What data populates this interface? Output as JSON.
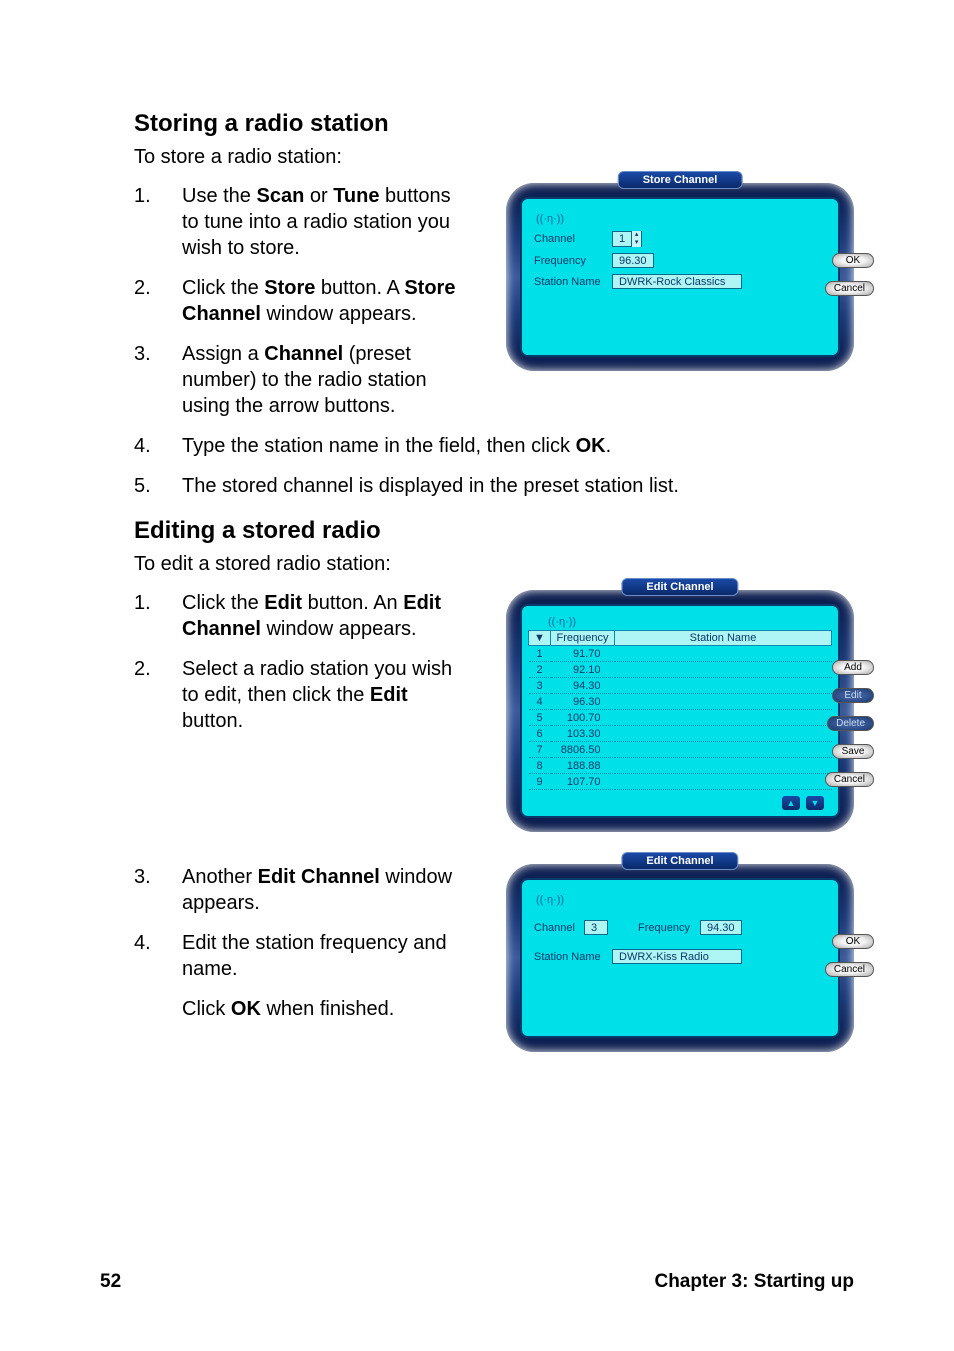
{
  "section1": {
    "heading": "Storing a radio station",
    "intro": "To store a radio station:",
    "steps_left": [
      {
        "n": "1.",
        "pre": "Use the ",
        "b1": "Scan",
        "mid": " or ",
        "b2": "Tune",
        "post": " buttons to tune into a radio station you wish to store."
      },
      {
        "n": "2.",
        "pre": "Click the ",
        "b1": "Store",
        "mid": " button. A ",
        "b2": "Store Channel",
        "post": " window appears."
      },
      {
        "n": "3.",
        "pre": "Assign a ",
        "b1": "Channel",
        "mid": "",
        "b2": "",
        "post": " (preset number) to the radio station using the arrow buttons."
      }
    ],
    "steps_full": [
      {
        "n": "4.",
        "pre": "Type the station name in the field, then click ",
        "b1": "OK",
        "mid": "",
        "b2": "",
        "post": "."
      },
      {
        "n": "5.",
        "pre": "The stored channel is displayed in the preset station list.",
        "b1": "",
        "mid": "",
        "b2": "",
        "post": ""
      }
    ]
  },
  "store_panel": {
    "title": "Store Channel",
    "icon": "((·η·))",
    "channel_label": "Channel",
    "channel_value": "1",
    "freq_label": "Frequency",
    "freq_value": "96.30",
    "name_label": "Station Name",
    "name_value": "DWRK-Rock Classics",
    "ok": "OK",
    "cancel": "Cancel"
  },
  "section2": {
    "heading": "Editing a stored radio",
    "intro": "To edit a stored radio station:",
    "steps_left": [
      {
        "n": "1.",
        "pre": "Click the ",
        "b1": "Edit",
        "mid": " button. An ",
        "b2": "Edit Channel",
        "post": " window appears."
      },
      {
        "n": "2.",
        "pre": "Select a radio station you wish to edit, then click the ",
        "b1": "Edit",
        "mid": "",
        "b2": "",
        "post": " button."
      }
    ],
    "steps_left2": [
      {
        "n": "3.",
        "pre": "Another ",
        "b1": "Edit Channel",
        "mid": "",
        "b2": "",
        "post": " window appears."
      },
      {
        "n": "4.",
        "pre": "Edit the station frequency and name.",
        "b1": "",
        "mid": "",
        "b2": "",
        "post": ""
      }
    ],
    "extra": {
      "pre": "Click ",
      "b1": "OK",
      "post": " when finished."
    }
  },
  "edit_list_panel": {
    "title": "Edit Channel",
    "icon": "((·η·))",
    "headers": {
      "ch": "▼",
      "freq": "Frequency",
      "name": "Station Name"
    },
    "rows": [
      {
        "ch": "1",
        "freq": "91.70",
        "name": ""
      },
      {
        "ch": "2",
        "freq": "92.10",
        "name": ""
      },
      {
        "ch": "3",
        "freq": "94.30",
        "name": ""
      },
      {
        "ch": "4",
        "freq": "96.30",
        "name": ""
      },
      {
        "ch": "5",
        "freq": "100.70",
        "name": ""
      },
      {
        "ch": "6",
        "freq": "103.30",
        "name": ""
      },
      {
        "ch": "7",
        "freq": "8806.50",
        "name": ""
      },
      {
        "ch": "8",
        "freq": "188.88",
        "name": ""
      },
      {
        "ch": "9",
        "freq": "107.70",
        "name": ""
      }
    ],
    "add": "Add",
    "edit": "Edit",
    "delete": "Delete",
    "save": "Save",
    "cancel": "Cancel"
  },
  "edit_single_panel": {
    "title": "Edit Channel",
    "icon": "((·η·))",
    "channel_label": "Channel",
    "channel_value": "3",
    "freq_label": "Frequency",
    "freq_value": "94.30",
    "name_label": "Station Name",
    "name_value": "DWRX-Kiss Radio",
    "ok": "OK",
    "cancel": "Cancel"
  },
  "footer": {
    "page": "52",
    "chapter": "Chapter 3: Starting up"
  }
}
